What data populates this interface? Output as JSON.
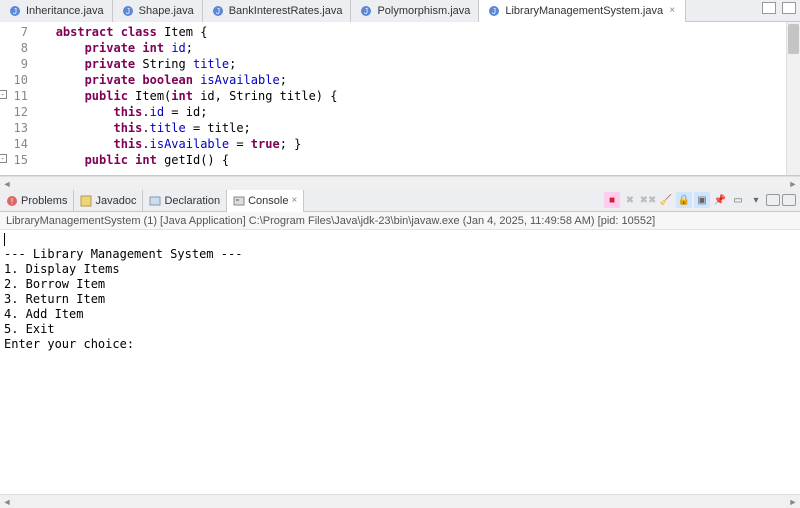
{
  "tabs": [
    {
      "label": "Inheritance.java"
    },
    {
      "label": "Shape.java"
    },
    {
      "label": "BankInterestRates.java"
    },
    {
      "label": "Polymorphism.java"
    },
    {
      "label": "LibraryManagementSystem.java"
    }
  ],
  "gutter": {
    "l7": "7",
    "l8": "8",
    "l9": "9",
    "l10": "10",
    "l11": "11",
    "l12": "12",
    "l13": "13",
    "l14": "14",
    "l15": "15"
  },
  "code": {
    "line7": {
      "indent": "   ",
      "kw1": "abstract",
      "sp1": " ",
      "kw2": "class",
      "rest": " Item {"
    },
    "line8": {
      "indent": "       ",
      "kw": "private",
      "sp": " ",
      "kw2": "int",
      "sp2": " ",
      "fld": "id",
      "rest": ";"
    },
    "line9": {
      "indent": "       ",
      "kw": "private",
      "sp": " ",
      "type": "String ",
      "fld": "title",
      "rest": ";"
    },
    "line10": {
      "indent": "       ",
      "kw": "private",
      "sp": " ",
      "kw2": "boolean",
      "sp2": " ",
      "fld": "isAvailable",
      "rest": ";"
    },
    "line11": {
      "indent": "       ",
      "kw": "public",
      "rest1": " Item(",
      "kw2": "int",
      "rest2": " id, String title) {"
    },
    "line12": {
      "indent": "           ",
      "kw": "this",
      "rest1": ".",
      "fld": "id",
      "rest2": " = id;"
    },
    "line13": {
      "indent": "           ",
      "kw": "this",
      "rest1": ".",
      "fld": "title",
      "rest2": " = title;"
    },
    "line14": {
      "indent": "           ",
      "kw": "this",
      "rest1": ".",
      "fld": "isAvailable",
      "rest2": " = ",
      "kw2": "true",
      "rest3": "; }"
    },
    "line15": {
      "indent": "       ",
      "kw": "public",
      "sp": " ",
      "kw2": "int",
      "rest": " getId() {"
    }
  },
  "views": {
    "problems": "Problems",
    "javadoc": "Javadoc",
    "declaration": "Declaration",
    "console": "Console"
  },
  "console": {
    "header": "LibraryManagementSystem (1) [Java Application] C:\\Program Files\\Java\\jdk-23\\bin\\javaw.exe  (Jan 4, 2025, 11:49:58 AM) [pid: 10552]",
    "l1": "--- Library Management System ---",
    "l2": "1. Display Items",
    "l3": "2. Borrow Item",
    "l4": "3. Return Item",
    "l5": "4. Add Item",
    "l6": "5. Exit",
    "l7": "Enter your choice: "
  }
}
